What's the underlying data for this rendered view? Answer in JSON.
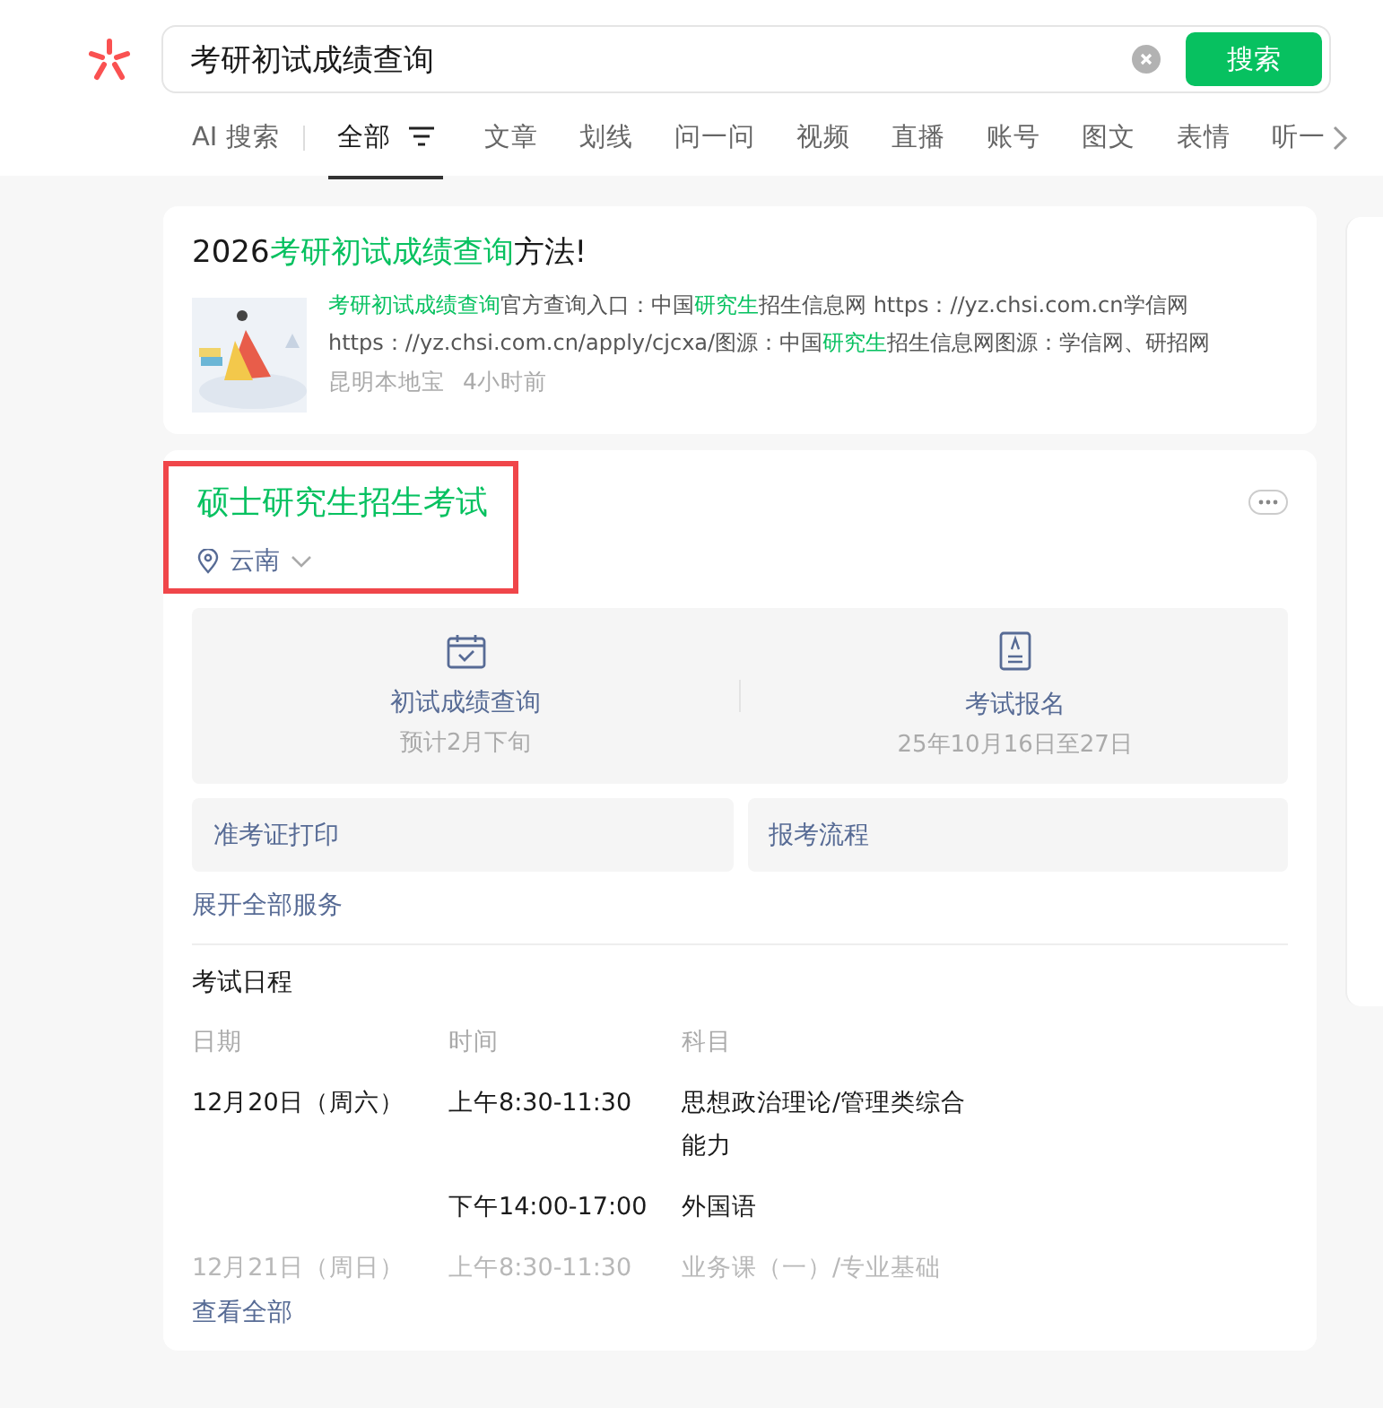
{
  "search": {
    "value": "考研初试成绩查询",
    "button": "搜索"
  },
  "tabs": [
    {
      "label": "AI 搜索",
      "selected": false
    },
    {
      "label": "全部",
      "selected": true
    },
    {
      "label": "文章",
      "selected": false
    },
    {
      "label": "划线",
      "selected": false
    },
    {
      "label": "问一问",
      "selected": false
    },
    {
      "label": "视频",
      "selected": false
    },
    {
      "label": "直播",
      "selected": false
    },
    {
      "label": "账号",
      "selected": false
    },
    {
      "label": "图文",
      "selected": false
    },
    {
      "label": "表情",
      "selected": false
    },
    {
      "label": "听一",
      "selected": false
    }
  ],
  "article": {
    "title": [
      {
        "text": "2026",
        "highlight": false
      },
      {
        "text": "考研初试成绩查询",
        "highlight": true
      },
      {
        "text": "方法!",
        "highlight": false
      }
    ],
    "snippet": [
      {
        "text": "考研初试成绩查询",
        "highlight": true
      },
      {
        "text": "官方查询入口：中国",
        "highlight": false
      },
      {
        "text": "研究生",
        "highlight": true
      },
      {
        "text": "招生信息网 https：//yz.chsi.com.cn学信网 https：//yz.chsi.com.cn/apply/cjcxa/图源：中国",
        "highlight": false
      },
      {
        "text": "研究生",
        "highlight": true
      },
      {
        "text": "招生信息网图源：学信网、研招网",
        "highlight": false
      }
    ],
    "source": "昆明本地宝",
    "time": "4小时前"
  },
  "exam": {
    "title": "硕士研究生招生考试",
    "region": "云南",
    "highlighted": true,
    "services": [
      {
        "title": "初试成绩查询",
        "sub": "预计2月下旬",
        "kind": "calendar"
      },
      {
        "title": "考试报名",
        "sub": "25年10月16日至27日",
        "kind": "document"
      }
    ],
    "buttons": [
      "准考证打印",
      "报考流程"
    ],
    "expand": "展开全部服务",
    "schedule": {
      "title": "考试日程",
      "columns": [
        "日期",
        "时间",
        "科目"
      ],
      "rows": [
        {
          "date": "12月20日（周六）",
          "time": "上午8:30-11:30",
          "subject": "思想政治理论/管理类综合能力",
          "faded": false
        },
        {
          "date": "",
          "time": "下午14:00-17:00",
          "subject": "外国语",
          "faded": false
        },
        {
          "date": "12月21日（周日）",
          "time": "上午8:30-11:30",
          "subject": "业务课（一）/专业基础",
          "faded": true
        }
      ],
      "more": "查看全部"
    }
  }
}
